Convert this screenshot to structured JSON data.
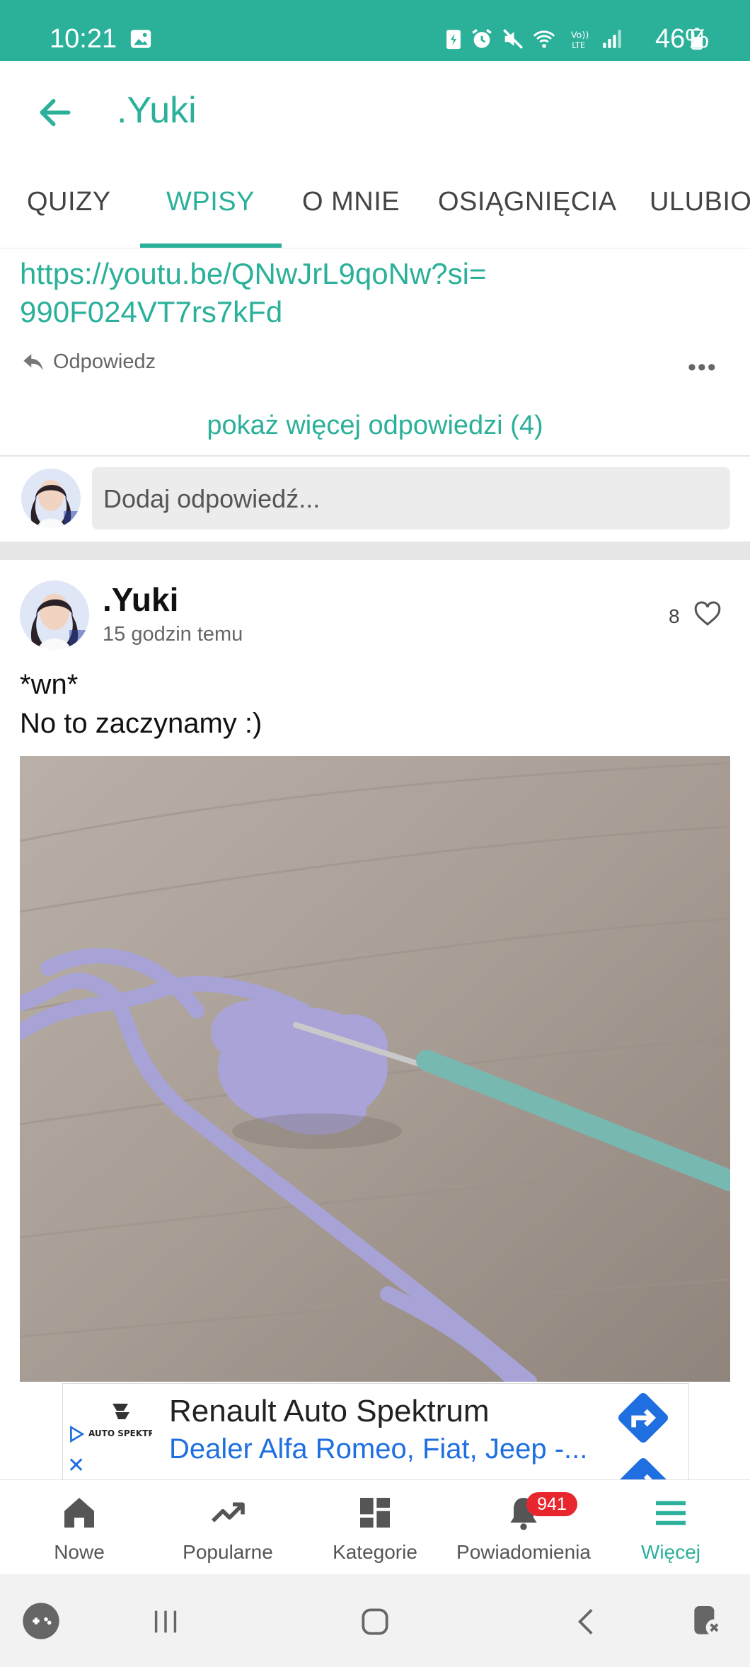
{
  "status_bar": {
    "time": "10:21",
    "battery": "46%"
  },
  "app_bar": {
    "title": ".Yuki"
  },
  "tabs": [
    {
      "label": "QUIZY"
    },
    {
      "label": "WPISY"
    },
    {
      "label": "O MNIE"
    },
    {
      "label": "OSIĄGNIĘCIA"
    },
    {
      "label": "ULUBIO"
    }
  ],
  "active_tab": "WPISY",
  "comment": {
    "link_line1": "https://youtu.be/QNwJrL9qoNw?si=",
    "link_line2": "990F024VT7rs7kFd",
    "reply_label": "Odpowiedz",
    "more": "•••"
  },
  "show_more": "pokaż więcej odpowiedzi (4)",
  "reply_input": {
    "placeholder": "Dodaj odpowiedź..."
  },
  "post": {
    "author": ".Yuki",
    "time": "15 godzin temu",
    "likes": "8",
    "line1": "*wn*",
    "line2": "No to zaczynamy :)"
  },
  "ad": {
    "title": "Renault Auto Spektrum",
    "subtitle": "Dealer Alfa Romeo, Fiat, Jeep -...",
    "logo_text": "AUTO SPEKTRUM",
    "close": "✕"
  },
  "bottom_nav": [
    {
      "label": "Nowe",
      "icon": "home-icon"
    },
    {
      "label": "Popularne",
      "icon": "trending-icon"
    },
    {
      "label": "Kategorie",
      "icon": "grid-icon"
    },
    {
      "label": "Powiadomienia",
      "icon": "bell-icon"
    },
    {
      "label": "Więcej",
      "icon": "menu-icon"
    }
  ],
  "notifications_badge": "941",
  "colors": {
    "accent": "#2bb09a",
    "badge": "#e8262d",
    "ad_blue": "#1f6fe0"
  }
}
